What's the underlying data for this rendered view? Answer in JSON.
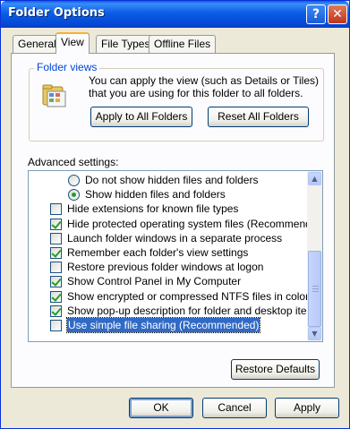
{
  "window": {
    "title": "Folder Options"
  },
  "titlebar": {
    "help_glyph": "?",
    "close_glyph": "✕"
  },
  "tabs": [
    {
      "label": "General",
      "active": false
    },
    {
      "label": "View",
      "active": true
    },
    {
      "label": "File Types",
      "active": false
    },
    {
      "label": "Offline Files",
      "active": false
    }
  ],
  "folder_views": {
    "label": "Folder views",
    "description": "You can apply the view (such as Details or Tiles) that you are using for this folder to all folders.",
    "apply_button": "Apply to All Folders",
    "reset_button": "Reset All Folders"
  },
  "advanced": {
    "label": "Advanced settings:",
    "items": [
      {
        "type": "radio",
        "label": "Do not show hidden files and folders",
        "checked": false,
        "indent": 1
      },
      {
        "type": "radio",
        "label": "Show hidden files and folders",
        "checked": true,
        "indent": 1
      },
      {
        "type": "checkbox",
        "label": "Hide extensions for known file types",
        "checked": false,
        "indent": 0
      },
      {
        "type": "checkbox",
        "label": "Hide protected operating system files (Recommended)",
        "checked": true,
        "indent": 0
      },
      {
        "type": "checkbox",
        "label": "Launch folder windows in a separate process",
        "checked": false,
        "indent": 0
      },
      {
        "type": "checkbox",
        "label": "Remember each folder's view settings",
        "checked": true,
        "indent": 0
      },
      {
        "type": "checkbox",
        "label": "Restore previous folder windows at logon",
        "checked": false,
        "indent": 0
      },
      {
        "type": "checkbox",
        "label": "Show Control Panel in My Computer",
        "checked": true,
        "indent": 0
      },
      {
        "type": "checkbox",
        "label": "Show encrypted or compressed NTFS files in color",
        "checked": true,
        "indent": 0
      },
      {
        "type": "checkbox",
        "label": "Show pop-up description for folder and desktop items",
        "checked": true,
        "indent": 0
      },
      {
        "type": "checkbox",
        "label": "Use simple file sharing (Recommended)",
        "checked": false,
        "indent": 0,
        "selected": true
      }
    ],
    "restore_defaults": "Restore Defaults"
  },
  "footer": {
    "ok": "OK",
    "cancel": "Cancel",
    "apply": "Apply"
  },
  "colors": {
    "titlebar": "#0a5ee6",
    "group_label": "#0046d5",
    "selection": "#316ac5",
    "check": "#21a121"
  }
}
